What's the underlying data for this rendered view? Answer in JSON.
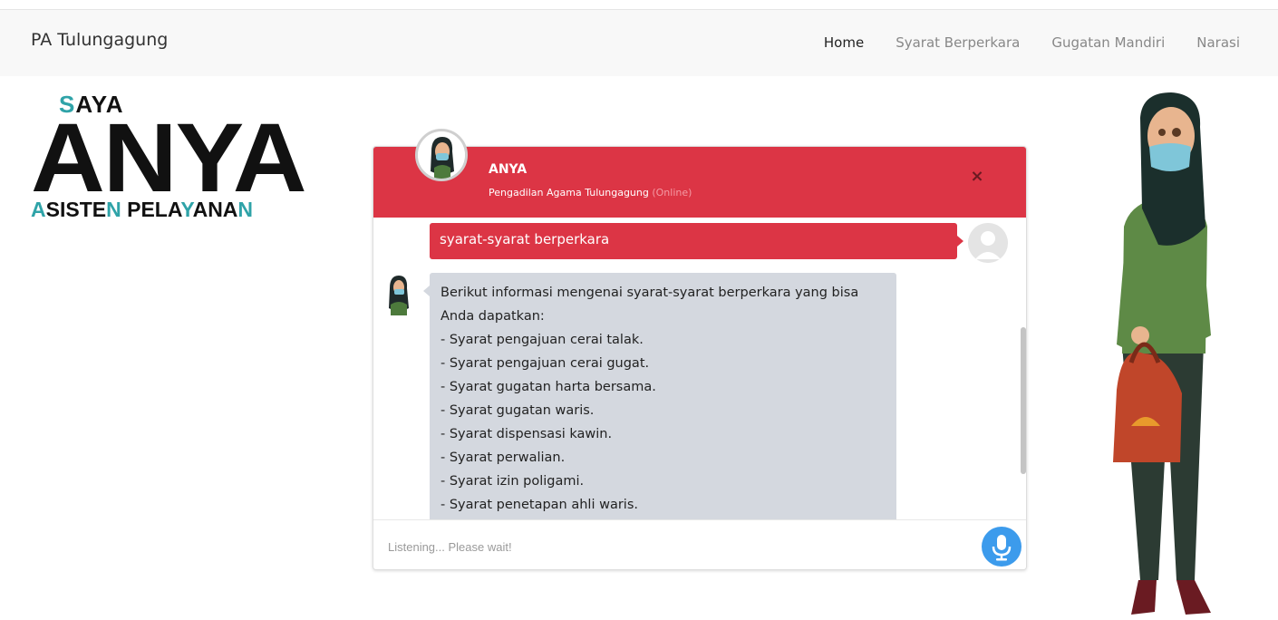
{
  "navbar": {
    "brand": "PA Tulungagung",
    "links": [
      {
        "label": "Home",
        "active": true
      },
      {
        "label": "Syarat Berperkara",
        "active": false
      },
      {
        "label": "Gugatan Mandiri",
        "active": false
      },
      {
        "label": "Narasi",
        "active": false
      }
    ]
  },
  "logo": {
    "saya_s": "S",
    "saya_rest": "AYA",
    "anya": "ANYA",
    "asisten_a": "A",
    "asisten_mid": "SISTE",
    "asisten_n": "N",
    "pelayanan_1": " PELA",
    "pelayanan_y": "Y",
    "pelayanan_2": "ANA",
    "pelayanan_n": "N"
  },
  "chat": {
    "header": {
      "name": "ANYA",
      "subtitle": "Pengadilan Agama Tulungagung",
      "status": "(Online)",
      "close_label": "×"
    },
    "user_message": "syarat-syarat berperkara",
    "bot_message": {
      "intro": "Berikut informasi mengenai syarat-syarat berperkara yang bisa Anda dapatkan:",
      "items": [
        "- Syarat pengajuan cerai talak.",
        "- Syarat pengajuan cerai gugat.",
        "- Syarat gugatan harta bersama.",
        "- Syarat gugatan waris.",
        "- Syarat dispensasi kawin.",
        "- Syarat perwalian.",
        "- Syarat izin poligami.",
        "- Syarat penetapan ahli waris."
      ]
    },
    "input": {
      "value": "",
      "placeholder": "Listening... Please wait!"
    },
    "icons": {
      "mic": "microphone-icon",
      "close": "close-icon"
    }
  },
  "colors": {
    "header_red": "#dc3545",
    "bot_bubble": "#d4d8df",
    "mic_blue": "#3c9bec",
    "logo_teal": "#2fa3a8"
  }
}
